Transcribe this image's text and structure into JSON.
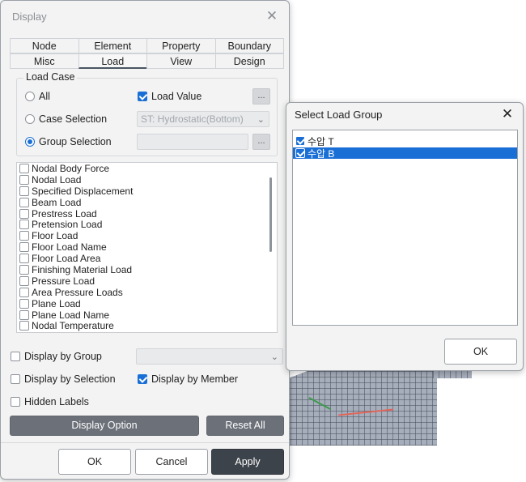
{
  "display_dialog": {
    "title": "Display",
    "tabs_row1": [
      "Node",
      "Element",
      "Property",
      "Boundary"
    ],
    "tabs_row2": [
      "Misc",
      "Load",
      "View",
      "Design"
    ],
    "active_tab": "Load",
    "load_case": {
      "group_label": "Load Case",
      "all_label": "All",
      "load_value_label": "Load Value",
      "case_selection_label": "Case Selection",
      "case_selection_value": "ST: Hydrostatic(Bottom)",
      "group_selection_label": "Group Selection",
      "ellipsis": "..."
    },
    "load_items": [
      "Nodal Body Force",
      "Nodal Load",
      "Specified Displacement",
      "Beam Load",
      "Prestress Load",
      "Pretension Load",
      "Floor Load",
      "Floor Load Name",
      "Floor Load Area",
      "Finishing Material Load",
      "Pressure Load",
      "Area Pressure Loads",
      "Plane Load",
      "Plane Load Name",
      "Nodal Temperature"
    ],
    "display_by_group_label": "Display by Group",
    "display_by_selection_label": "Display by Selection",
    "display_by_member_label": "Display by Member",
    "hidden_labels_label": "Hidden Labels",
    "display_option_label": "Display Option",
    "reset_all_label": "Reset All",
    "ok_label": "OK",
    "cancel_label": "Cancel",
    "apply_label": "Apply",
    "close_glyph": "✕"
  },
  "load_group_dialog": {
    "title": "Select Load Group",
    "items": [
      {
        "label": "수압 T",
        "checked": true,
        "selected": false
      },
      {
        "label": "수압 B",
        "checked": true,
        "selected": true
      }
    ],
    "ok_label": "OK",
    "close_glyph": "✕"
  },
  "colors": {
    "accent": "#1a6fd6",
    "apply_button": "#3d434b",
    "display_option_button": "#6b7079"
  }
}
